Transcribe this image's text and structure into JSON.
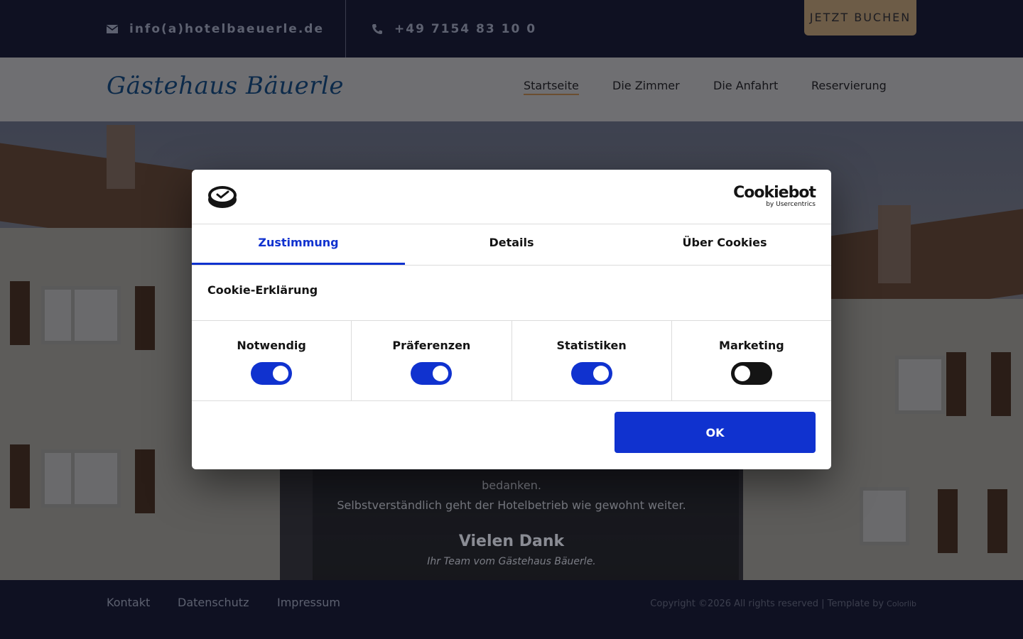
{
  "topbar": {
    "email": "info(a)hotelbaeuerle.de",
    "phone": "+49 7154 83 10 0",
    "book_label": "JETZT BUCHEN",
    "email_icon": "envelope-icon",
    "phone_icon": "phone-icon"
  },
  "nav": {
    "logo": "Gästehaus Bäuerle",
    "items": [
      "Startseite",
      "Die Zimmer",
      "Die Anfahrt",
      "Reservierung"
    ],
    "active_index": 0
  },
  "notice": {
    "line1": "bedanken.",
    "line2": "Selbstverständlich geht der Hotelbetrieb wie gewohnt weiter.",
    "thanks": "Vielen Dank",
    "team": "Ihr Team vom Gästehaus Bäuerle."
  },
  "footer": {
    "links": [
      "Kontakt",
      "Datenschutz",
      "Impressum"
    ],
    "copyright": "Copyright ©2026 All rights reserved | Template by",
    "template_by": "Colorlib"
  },
  "cookie_dialog": {
    "brand_name": "Cookiebot",
    "brand_by": "by Usercentrics",
    "tabs": [
      "Zustimmung",
      "Details",
      "Über Cookies"
    ],
    "active_tab": 0,
    "heading": "Cookie-Erklärung",
    "categories": [
      {
        "label": "Notwendig",
        "enabled": true
      },
      {
        "label": "Präferenzen",
        "enabled": true
      },
      {
        "label": "Statistiken",
        "enabled": true
      },
      {
        "label": "Marketing",
        "enabled": false
      }
    ],
    "ok_label": "OK",
    "accent_color": "#1032cf"
  }
}
